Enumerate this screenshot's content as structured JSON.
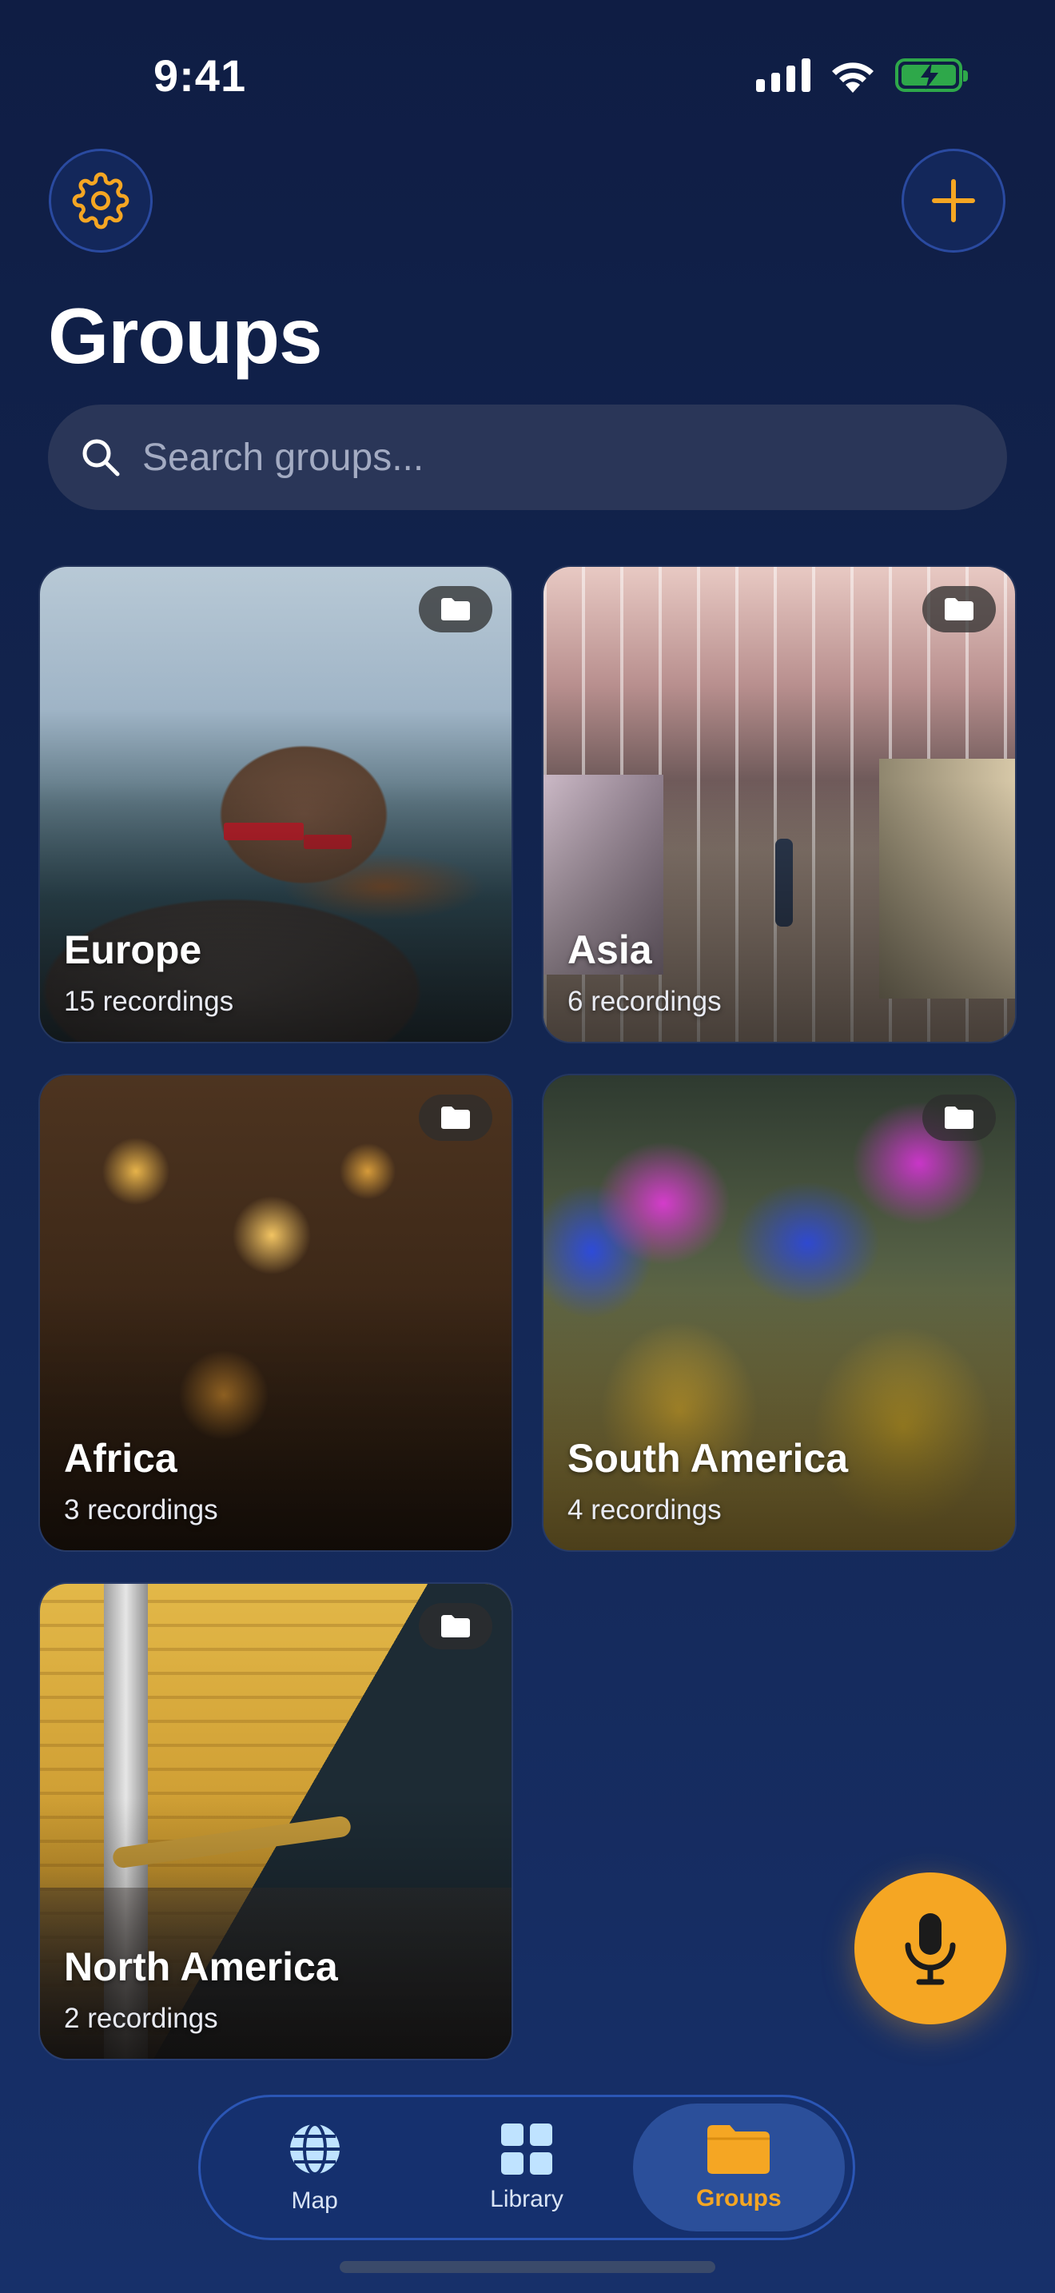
{
  "status_bar": {
    "time": "9:41"
  },
  "header": {
    "settings_icon": "gear-icon",
    "add_icon": "plus-icon",
    "title": "Groups"
  },
  "search": {
    "placeholder": "Search groups...",
    "value": ""
  },
  "groups": [
    {
      "name": "Europe",
      "count": "15 recordings"
    },
    {
      "name": "Asia",
      "count": "6 recordings"
    },
    {
      "name": "Africa",
      "count": "3 recordings"
    },
    {
      "name": "South America",
      "count": "4 recordings"
    },
    {
      "name": "North America",
      "count": "2 recordings"
    }
  ],
  "fab": {
    "icon": "microphone-icon"
  },
  "tabbar": {
    "tabs": [
      {
        "label": "Map",
        "icon": "globe-icon"
      },
      {
        "label": "Library",
        "icon": "grid-icon"
      },
      {
        "label": "Groups",
        "icon": "folder-icon",
        "active": true
      }
    ]
  },
  "colors": {
    "accent": "#f5a623",
    "background": "#132651",
    "active_tab": "#2b4f9a"
  }
}
